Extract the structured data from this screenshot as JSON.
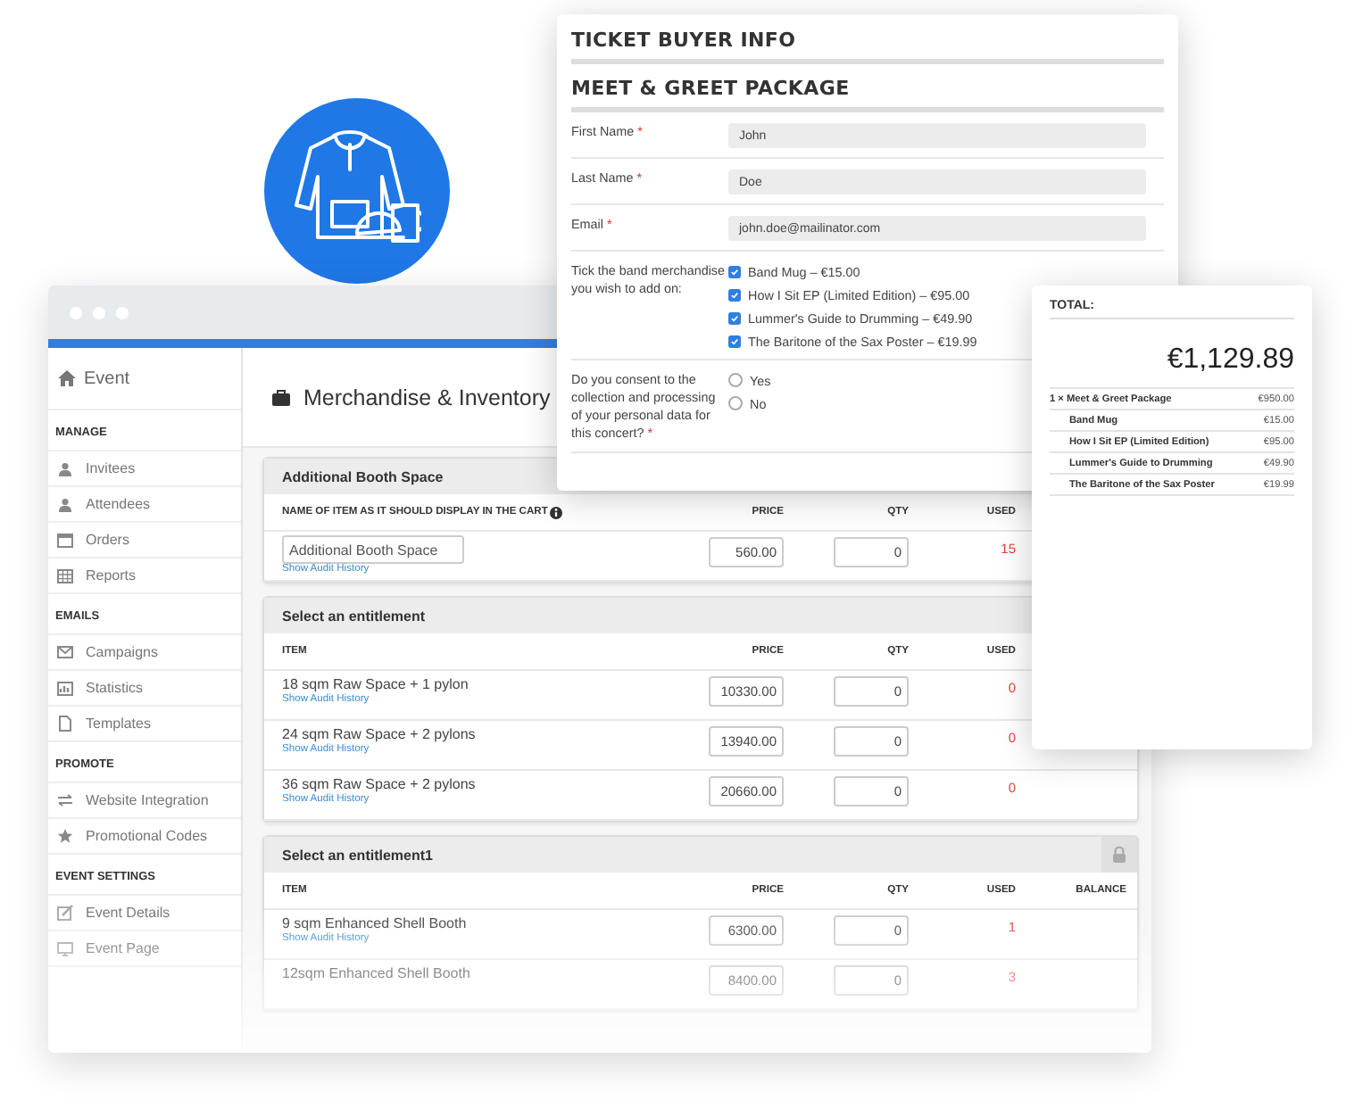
{
  "admin_window": {
    "sidebar": {
      "title": "Event",
      "groups": [
        {
          "heading": "MANAGE",
          "items": [
            {
              "label": "Invitees"
            },
            {
              "label": "Attendees"
            },
            {
              "label": "Orders"
            },
            {
              "label": "Reports"
            }
          ]
        },
        {
          "heading": "EMAILS",
          "items": [
            {
              "label": "Campaigns"
            },
            {
              "label": "Statistics"
            },
            {
              "label": "Templates"
            }
          ]
        },
        {
          "heading": "PROMOTE",
          "items": [
            {
              "label": "Website Integration"
            },
            {
              "label": "Promotional Codes"
            }
          ]
        },
        {
          "heading": "EVENT SETTINGS",
          "items": [
            {
              "label": "Event Details"
            },
            {
              "label": "Event Page"
            }
          ]
        }
      ]
    },
    "page_title": "Merchandise & Inventory",
    "sections": [
      {
        "title": "Additional Booth Space",
        "kind": "named",
        "columns": [
          "NAME OF ITEM AS IT SHOULD DISPLAY IN THE CART",
          "PRICE",
          "QTY",
          "USED"
        ],
        "rows": [
          {
            "item": "Additional Booth Space",
            "link": "Show Audit History",
            "price": "560.00",
            "qty": "0",
            "used": "15"
          }
        ]
      },
      {
        "title": "Select an entitlement",
        "kind": "list",
        "columns": [
          "ITEM",
          "PRICE",
          "QTY",
          "USED"
        ],
        "rows": [
          {
            "item": "18 sqm Raw Space + 1 pylon",
            "link": "Show Audit History",
            "price": "10330.00",
            "qty": "0",
            "used": "0"
          },
          {
            "item": "24 sqm Raw Space + 2 pylons",
            "link": "Show Audit History",
            "price": "13940.00",
            "qty": "0",
            "used": "0"
          },
          {
            "item": "36 sqm Raw Space + 2 pylons",
            "link": "Show Audit History",
            "price": "20660.00",
            "qty": "0",
            "used": "0"
          }
        ]
      },
      {
        "title": "Select an entitlement1",
        "kind": "list",
        "locked": true,
        "columns": [
          "ITEM",
          "PRICE",
          "QTY",
          "USED",
          "BALANCE"
        ],
        "rows": [
          {
            "item": "9 sqm Enhanced Shell Booth",
            "link": "Show Audit History",
            "price": "6300.00",
            "qty": "0",
            "used": "1"
          },
          {
            "item": "12sqm Enhanced Shell Booth",
            "price": "8400.00",
            "qty": "0",
            "used": "3"
          }
        ]
      }
    ]
  },
  "ticket_form": {
    "title": "TICKET BUYER INFO",
    "subtitle": "MEET & GREET PACKAGE",
    "fields": [
      {
        "kind": "text",
        "label": "First Name",
        "required_mark": "*",
        "value": "John"
      },
      {
        "kind": "text",
        "label": "Last Name",
        "required_mark": "*",
        "value": "Doe"
      },
      {
        "kind": "text",
        "label": "Email",
        "required_mark": "*",
        "value": "john.doe@mailinator.com"
      },
      {
        "kind": "checkboxes",
        "label": "Tick the band merchandise you wish to add on:",
        "options": [
          {
            "label": "Band Mug – €15.00",
            "checked": true
          },
          {
            "label": "How I Sit EP (Limited Edition) – €95.00",
            "checked": true
          },
          {
            "label": "Lummer's Guide to Drumming – €49.90",
            "checked": true
          },
          {
            "label": "The Baritone of the Sax Poster – €19.99",
            "checked": true
          }
        ]
      },
      {
        "kind": "radios",
        "label": "Do you consent to the collection and processing of your personal data for this concert?",
        "required_mark": "*",
        "options": [
          {
            "label": "Yes",
            "selected": false
          },
          {
            "label": "No",
            "selected": false
          }
        ]
      }
    ]
  },
  "total_card": {
    "heading": "TOTAL:",
    "amount": "€1,129.89",
    "lines": [
      {
        "kind": "package",
        "label": "1 × Meet & Greet Package",
        "price": "€950.00"
      },
      {
        "kind": "addon",
        "label": "Band Mug",
        "price": "€15.00"
      },
      {
        "kind": "addon",
        "label": "How I Sit EP (Limited Edition)",
        "price": "€95.00"
      },
      {
        "kind": "addon",
        "label": "Lummer's Guide to Drumming",
        "price": "€49.90"
      },
      {
        "kind": "addon",
        "label": "The Baritone of the Sax Poster",
        "price": "€19.99"
      }
    ]
  }
}
